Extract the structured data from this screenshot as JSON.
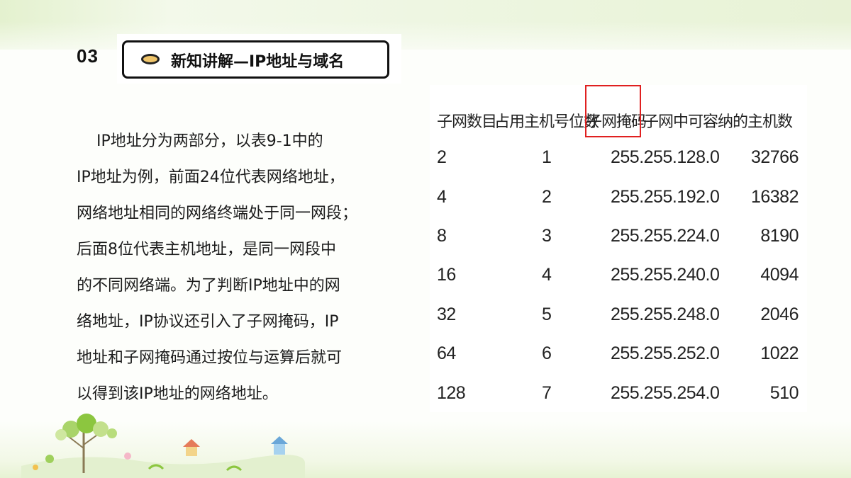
{
  "section": {
    "number": "03"
  },
  "title": {
    "text": "新知讲解—IP地址与域名"
  },
  "paragraph": {
    "lines": [
      "    IP地址分为两部分，以表9-1中的",
      "IP地址为例，前面24位代表网络地址，",
      "网络地址相同的网络终端处于同一网段；",
      "后面8位代表主机地址，是同一网段中",
      "的不同网络端。为了判断IP地址中的网",
      "络地址，IP协议还引入了子网掩码，IP",
      "地址和子网掩码通过按位与运算后就可",
      "以得到该IP地址的网络地址。"
    ]
  },
  "table": {
    "headers": [
      "子网数目",
      "占用主机号位数",
      "子网掩码",
      "子网中可容纳的主机数"
    ],
    "rows": [
      [
        "2",
        "1",
        "255.255.128.0",
        "32766"
      ],
      [
        "4",
        "2",
        "255.255.192.0",
        "16382"
      ],
      [
        "8",
        "3",
        "255.255.224.0",
        "8190"
      ],
      [
        "16",
        "4",
        "255.255.240.0",
        "4094"
      ],
      [
        "32",
        "5",
        "255.255.248.0",
        "2046"
      ],
      [
        "64",
        "6",
        "255.255.252.0",
        "1022"
      ],
      [
        "128",
        "7",
        "255.255.254.0",
        "510"
      ]
    ],
    "highlight_color": "#e02020"
  },
  "colors": {
    "title_dot": "#f0c56a",
    "background": "#fdfefb",
    "accent_green": "#8cc63f"
  },
  "icons": {
    "title_marker": "oval-bullet-icon",
    "decoration": "tree-house-landscape-icon"
  }
}
